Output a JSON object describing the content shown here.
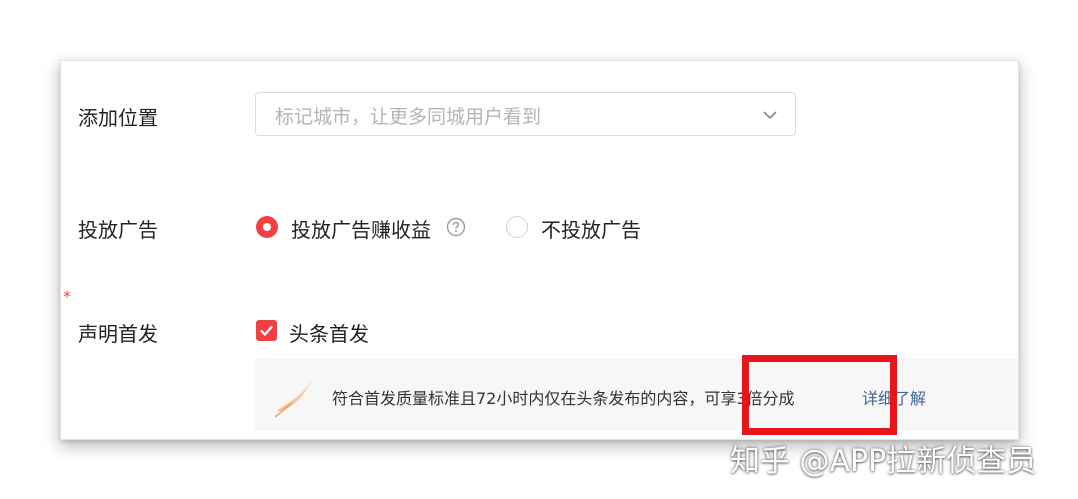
{
  "location": {
    "label": "添加位置",
    "placeholder": "标记城市，让更多同城用户看到"
  },
  "ads": {
    "required_mark": "*",
    "label": "投放广告",
    "options": [
      {
        "label": "投放广告赚收益",
        "selected": true
      },
      {
        "label": "不投放广告",
        "selected": false
      }
    ]
  },
  "first_publish": {
    "label": "声明首发",
    "checkbox_label": "头条首发",
    "checked": true,
    "tip_text": "符合首发质量标准且72小时内仅在头条发布的内容，可享3倍分成",
    "tip_link": "详细了解"
  },
  "watermark": "知乎 @APP拉新侦查员",
  "colors": {
    "accent": "#f04142",
    "link": "#406599",
    "highlight": "#e8141a"
  }
}
